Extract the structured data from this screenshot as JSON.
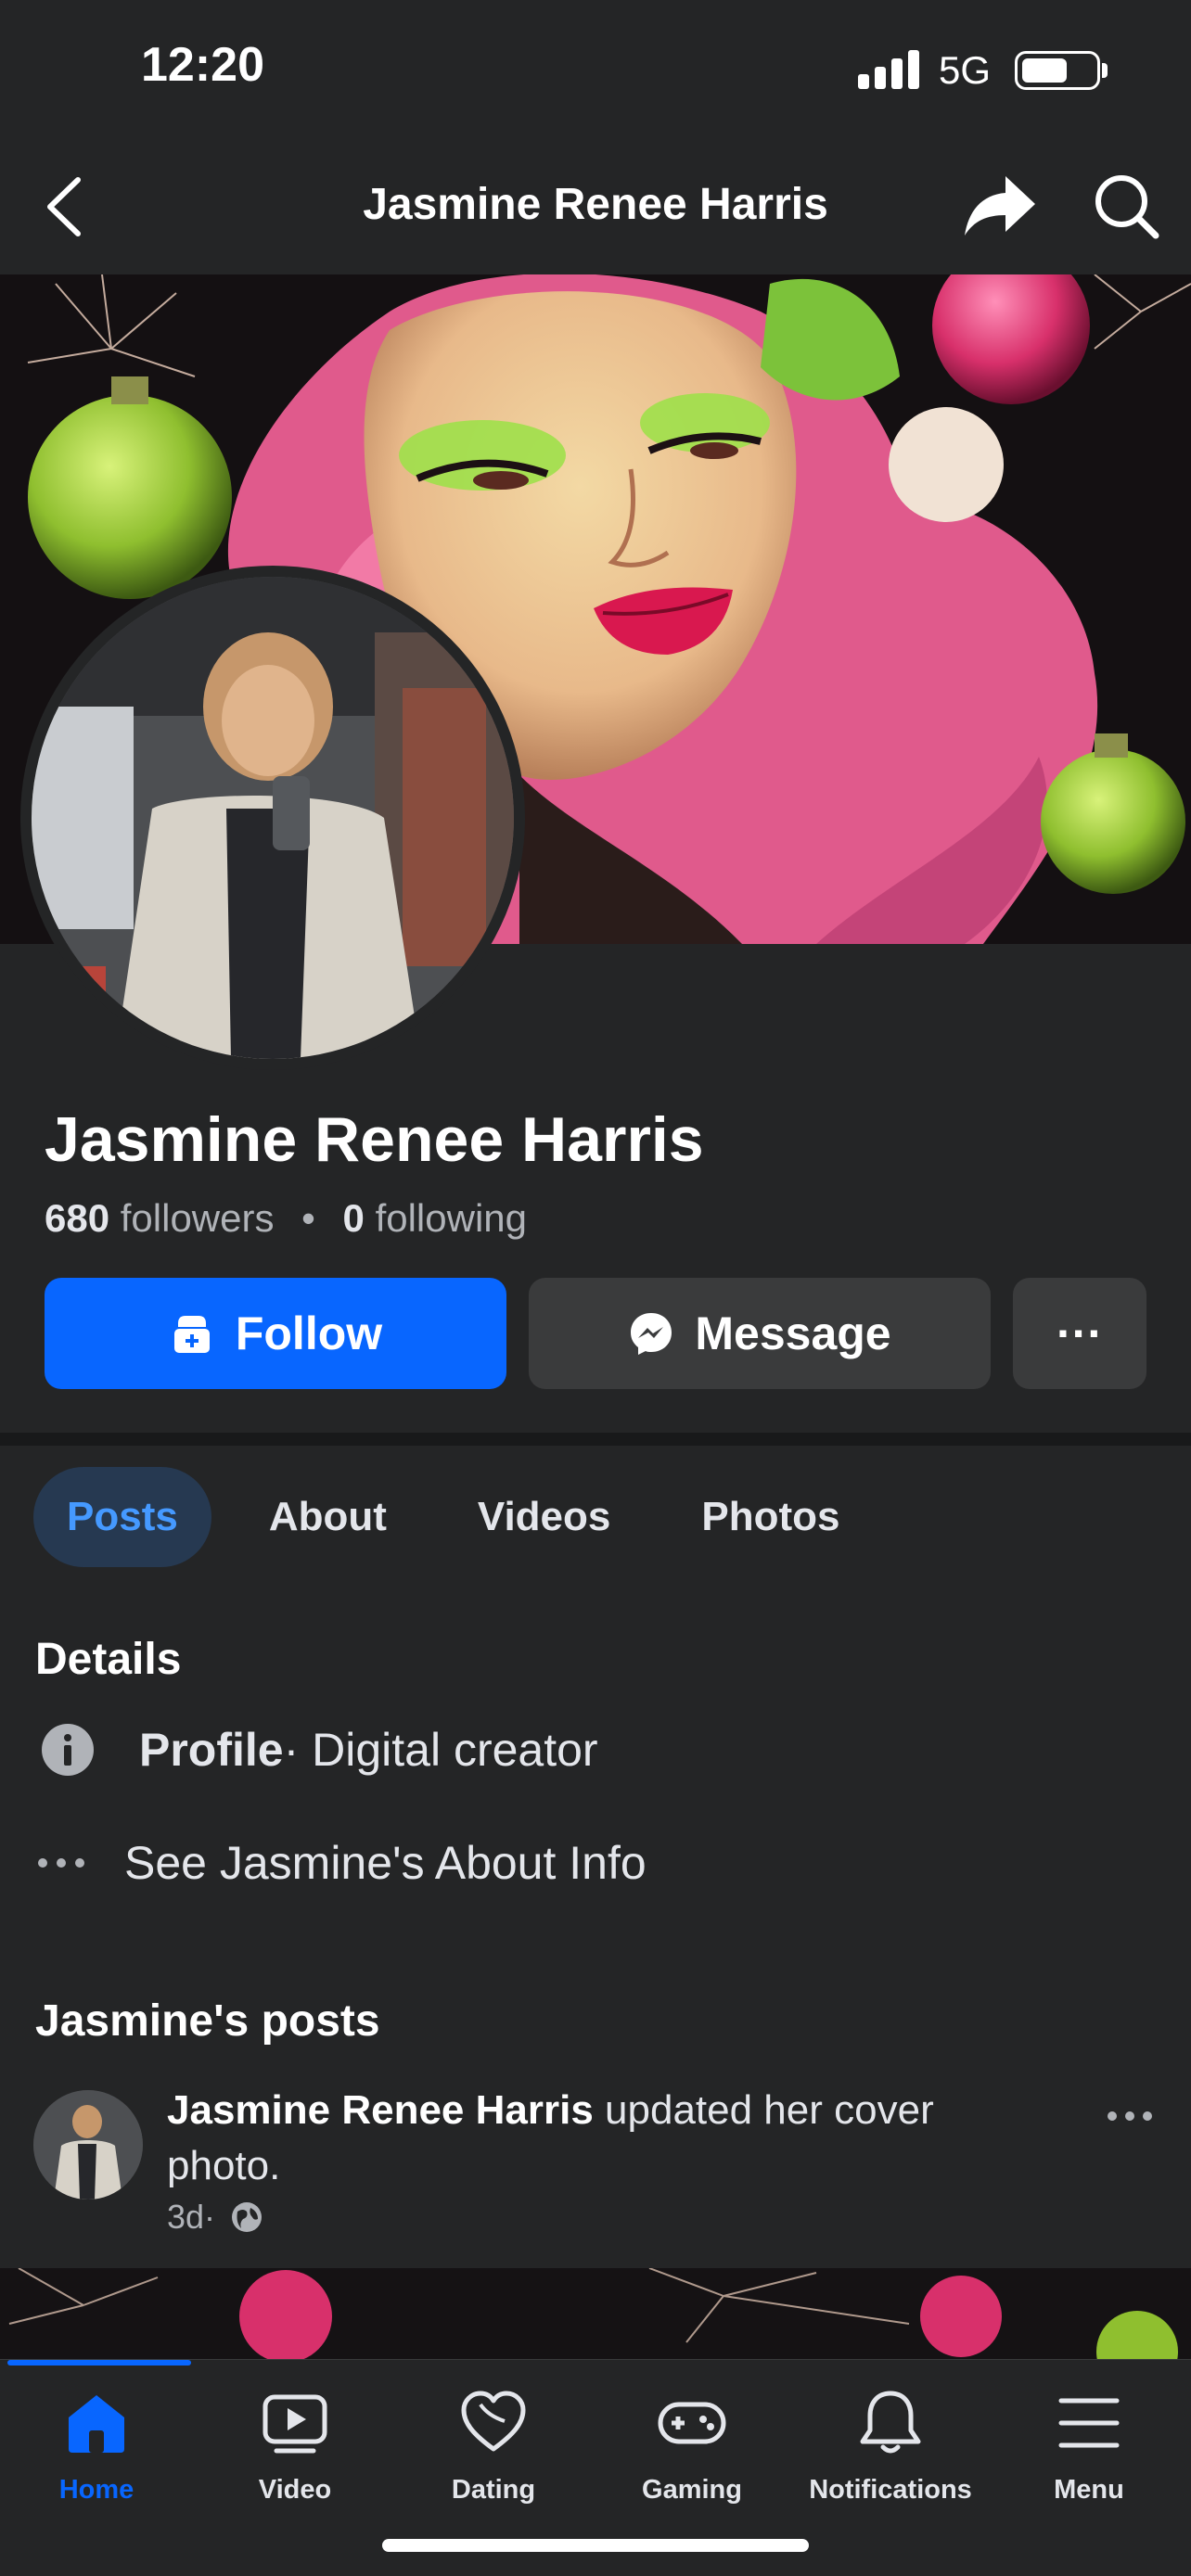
{
  "status_bar": {
    "time": "12:20",
    "network": "5G"
  },
  "header": {
    "title": "Jasmine Renee Harris"
  },
  "profile": {
    "name": "Jasmine Renee Harris",
    "followers_count": "680",
    "followers_label": "followers",
    "separator": "•",
    "following_count": "0",
    "following_label": "following"
  },
  "actions": {
    "follow_label": "Follow",
    "message_label": "Message",
    "more_label": "···"
  },
  "tabs": [
    {
      "label": "Posts",
      "active": true
    },
    {
      "label": "About",
      "active": false
    },
    {
      "label": "Videos",
      "active": false
    },
    {
      "label": "Photos",
      "active": false
    }
  ],
  "details": {
    "title": "Details",
    "profile_label": "Profile",
    "profile_value": " · Digital creator",
    "see_about": "See Jasmine's About Info"
  },
  "posts": {
    "title": "Jasmine's posts",
    "item": {
      "author": "Jasmine Renee Harris",
      "text": " updated her cover photo.",
      "time": "3d",
      "meta_sep": " ·"
    }
  },
  "bottom_nav": [
    {
      "label": "Home",
      "icon": "home-icon",
      "active": true
    },
    {
      "label": "Video",
      "icon": "video-icon",
      "active": false
    },
    {
      "label": "Dating",
      "icon": "dating-heart-icon",
      "active": false
    },
    {
      "label": "Gaming",
      "icon": "gamepad-icon",
      "active": false
    },
    {
      "label": "Notifications",
      "icon": "bell-icon",
      "active": false
    },
    {
      "label": "Menu",
      "icon": "menu-icon",
      "active": false
    }
  ],
  "colors": {
    "background": "#242526",
    "accent": "#0866ff",
    "active_tab_bg": "#263951",
    "active_tab_text": "#4599ff",
    "button_gray": "#3a3b3c"
  }
}
